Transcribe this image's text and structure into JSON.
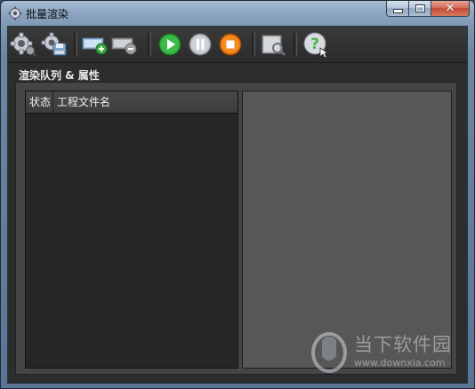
{
  "window": {
    "title": "批量渲染",
    "icon": "gear-icon"
  },
  "caption_buttons": {
    "minimize_icon": "minimize-icon",
    "maximize_icon": "maximize-icon",
    "close_icon": "close-icon",
    "close_glyph": "✕"
  },
  "toolbar": {
    "buttons": [
      {
        "icon": "render-settings-gear-icon"
      },
      {
        "icon": "save-settings-icon"
      },
      {
        "icon": "add-to-queue-icon"
      },
      {
        "icon": "remove-from-queue-icon"
      },
      {
        "icon": "play-icon"
      },
      {
        "icon": "pause-icon"
      },
      {
        "icon": "stop-icon"
      },
      {
        "icon": "preview-icon"
      },
      {
        "icon": "help-icon"
      }
    ]
  },
  "section": {
    "label": "渲染队列 & 属性"
  },
  "queue": {
    "columns": [
      "状态",
      "工程文件名"
    ],
    "rows": []
  },
  "watermark": {
    "text": "当下软件园",
    "url": "www.downxia.com"
  },
  "colors": {
    "play_green": "#2fa83a",
    "stop_orange": "#f07a10",
    "help_green": "#43b64a"
  }
}
